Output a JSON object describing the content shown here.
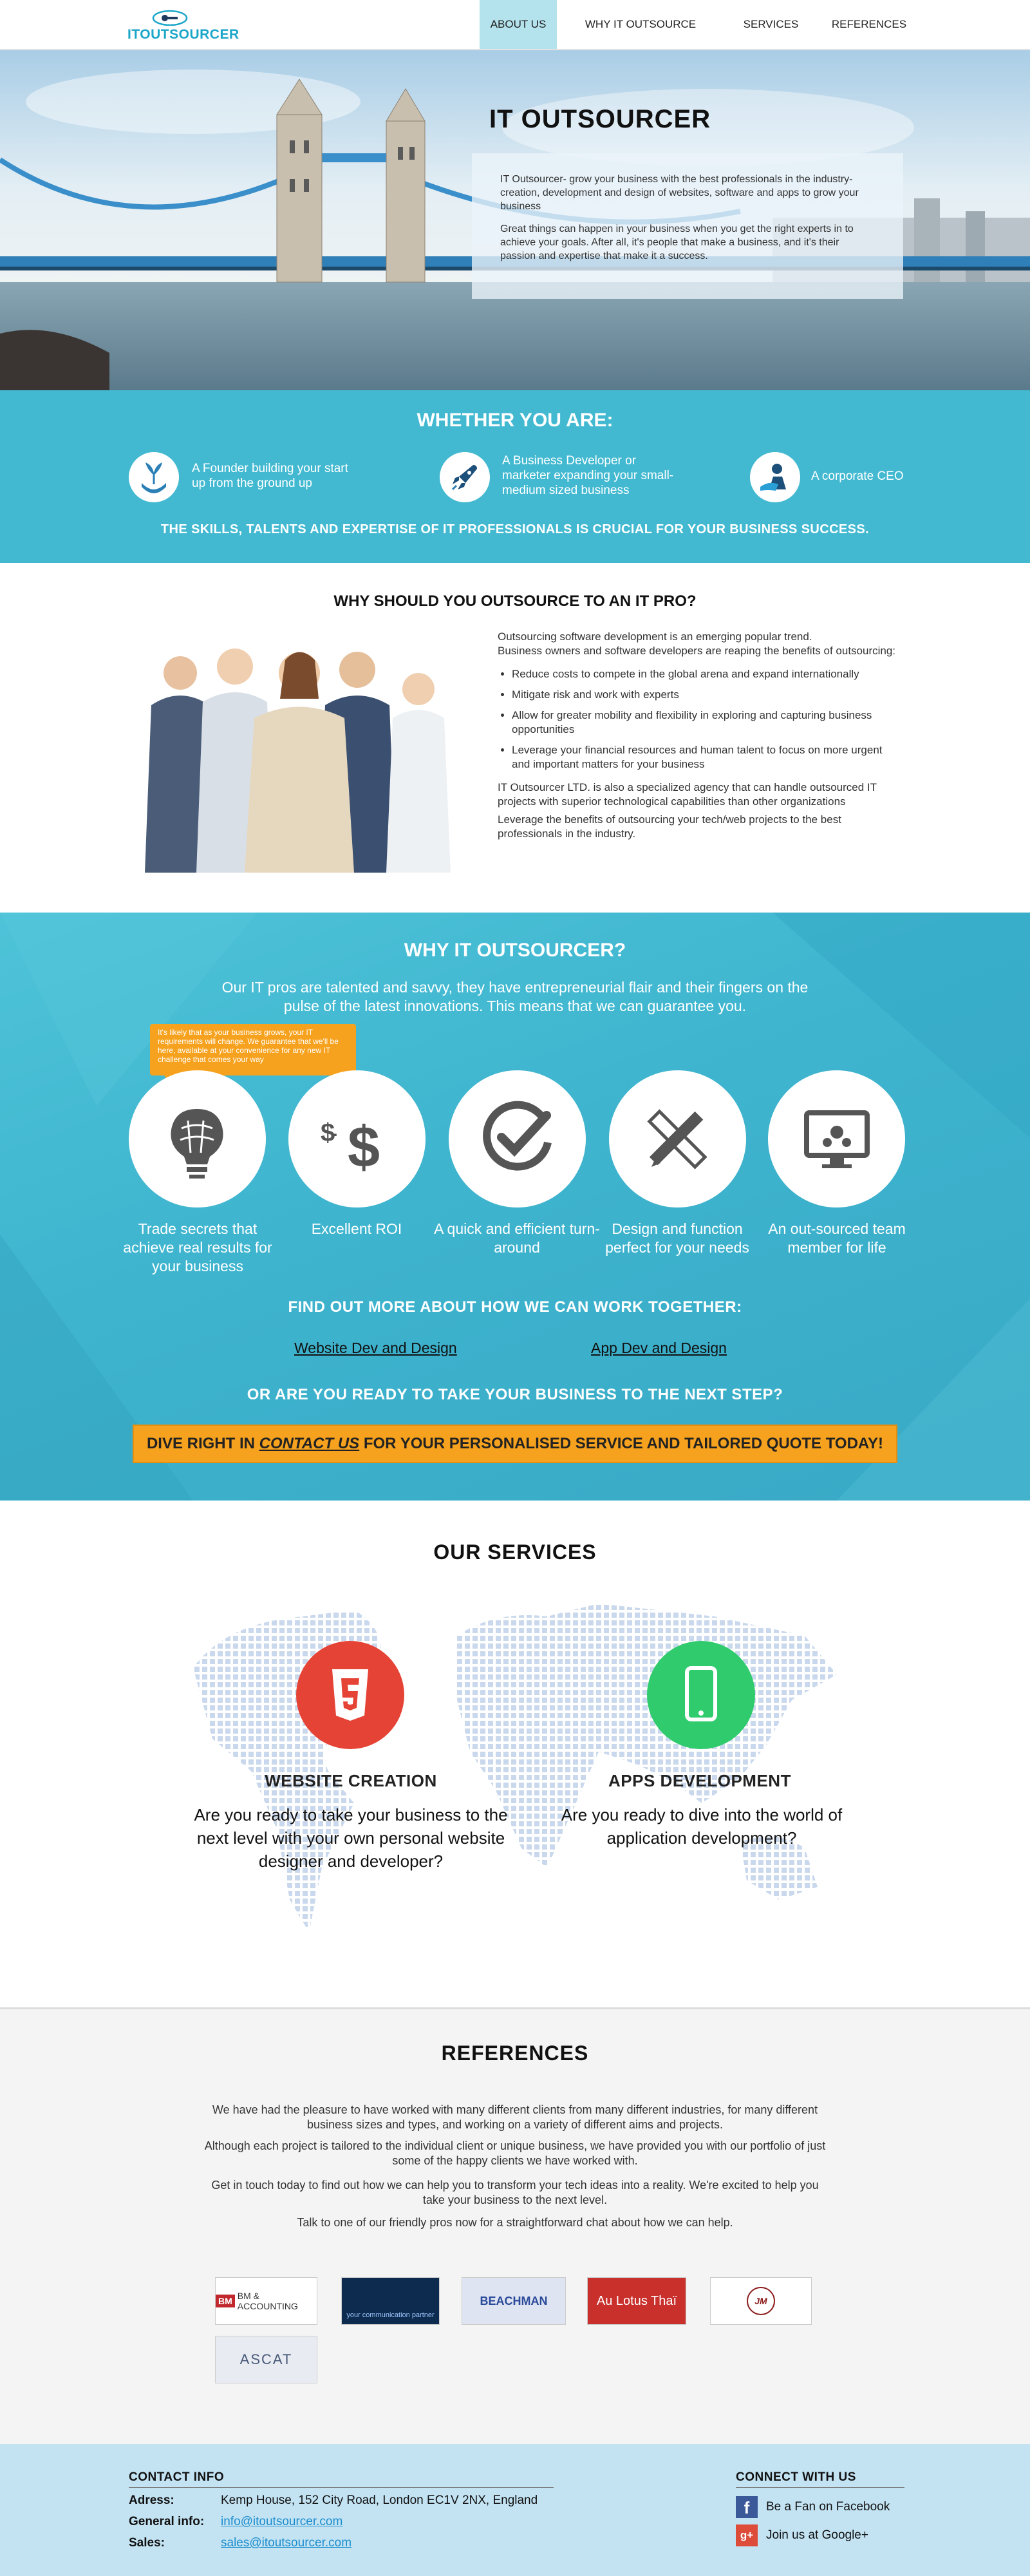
{
  "nav": {
    "logo_text": "ITOUTSOURCER",
    "items": [
      {
        "label": "ABOUT US"
      },
      {
        "label": "WHY IT OUTSOURCE"
      },
      {
        "label": "SERVICES"
      },
      {
        "label": "REFERENCES"
      }
    ]
  },
  "hero": {
    "title": "IT OUTSOURCER",
    "p1": "IT Outsourcer- grow your business with the best professionals in the industry- creation, development and design of websites, software and apps to grow your business",
    "p2": "Great things can happen in your business when you get the right experts in to achieve your goals. After all, it's people that make a business, and it's their passion and expertise that make it a success."
  },
  "whether": {
    "title": "WHETHER YOU ARE:",
    "roles": [
      {
        "text": "A Founder building your start up from the ground up",
        "icon": "seedling-hand-icon"
      },
      {
        "text": "A Business Developer or marketer expanding your small-medium sized business",
        "icon": "rocket-icon"
      },
      {
        "text": "A corporate CEO",
        "icon": "ceo-person-icon"
      }
    ],
    "tagline": "THE SKILLS, TALENTS AND EXPERTISE OF IT PROFESSIONALS IS CRUCIAL FOR YOUR BUSINESS SUCCESS."
  },
  "why_pro": {
    "title": "WHY SHOULD YOU OUTSOURCE TO AN IT PRO?",
    "intro1": "Outsourcing software development is an emerging popular trend.",
    "intro2": "Business owners and software developers are reaping the benefits of outsourcing:",
    "bullets": [
      "Reduce costs to compete in the global arena and expand internationally",
      "Mitigate risk and work with experts",
      "Allow for greater mobility and flexibility in exploring and capturing business opportunities",
      "Leverage your financial resources and human talent to focus on more urgent and important matters for your business"
    ],
    "outro1": "IT Outsourcer LTD. is also a specialized agency that can handle outsourced IT projects with superior technological capabilities than other organizations",
    "outro2": "Leverage the benefits of outsourcing your tech/web projects to the best professionals in the industry."
  },
  "why_it": {
    "title": "WHY IT OUTSOURCER?",
    "subtitle": "Our IT pros are talented and savvy, they have entrepreneurial flair and their fingers on the pulse of the latest innovations. This means that we can guarantee you.",
    "tooltip": "It's likely that as your business grows, your IT requirements will change. We guarantee that we'll be here, available at your convenience for any new IT challenge that comes your way",
    "features": [
      {
        "label": "Trade secrets that achieve real results for your business",
        "icon": "brain-bulb-icon"
      },
      {
        "label": "Excellent ROI",
        "icon": "dollar-icon"
      },
      {
        "label": "A quick and efficient turn-around",
        "icon": "checkmark-icon"
      },
      {
        "label": "Design and function perfect for your needs",
        "icon": "pencil-ruler-icon"
      },
      {
        "label": "An out-sourced team member for life",
        "icon": "monitor-gears-icon"
      }
    ],
    "find_out": "FIND OUT MORE ABOUT HOW WE CAN WORK TOGETHER:",
    "link1": "Website Dev and Design",
    "link2": "App Dev and Design",
    "ready": "OR ARE YOU READY TO TAKE YOUR BUSINESS TO THE NEXT STEP?",
    "cta_pre": "DIVE RIGHT IN ",
    "cta_link": "CONTACT US",
    "cta_post": " FOR YOUR PERSONALISED SERVICE AND TAILORED QUOTE TODAY!"
  },
  "services": {
    "title": "OUR SERVICES",
    "web_title": "WEBSITE CREATION",
    "web_text": "Are you ready to take your business to the next level with your own personal website designer and developer?",
    "app_title": "APPS DEVELOPMENT",
    "app_text": "Are you ready to dive into the world of application development?"
  },
  "references": {
    "title": "REFERENCES",
    "p1": "We have had the pleasure to have worked with many different clients from many different industries, for many different business sizes and types, and working on a variety of different aims and projects.",
    "p2": "Although each project is tailored to the individual client or unique business, we have provided you with our portfolio of just some of the happy clients we have worked with.",
    "p3": "Get in touch today to find out how we can help you to transform your tech ideas into a reality. We're excited to help you take your business to the next level.",
    "p4": "Talk to one of our friendly pros now for a straightforward chat about how we can help.",
    "clients": [
      {
        "name": "BM & ACCOUNTING"
      },
      {
        "name": "your communication partner"
      },
      {
        "name": "BEACHMAN"
      },
      {
        "name": "Au Lotus Thaï"
      },
      {
        "name": "JM"
      },
      {
        "name": "ASCAT"
      }
    ]
  },
  "footer": {
    "contact_title": "CONTACT INFO",
    "address_label": "Adress:",
    "address": "Kemp House, 152 City Road, London EC1V 2NX, England",
    "general_label": "General info:",
    "general_email": "info@itoutsourcer.com",
    "sales_label": "Sales:",
    "sales_email": "sales@itoutsourcer.com",
    "connect_title": "CONNECT WITH US",
    "facebook": "Be a Fan on Facebook",
    "google": "Join us at Google+"
  },
  "colors": {
    "teal": "#42b9d1",
    "orange": "#f6a21e",
    "red": "#e54335",
    "green": "#2fcb6c",
    "footer": "#c3e3f3"
  }
}
